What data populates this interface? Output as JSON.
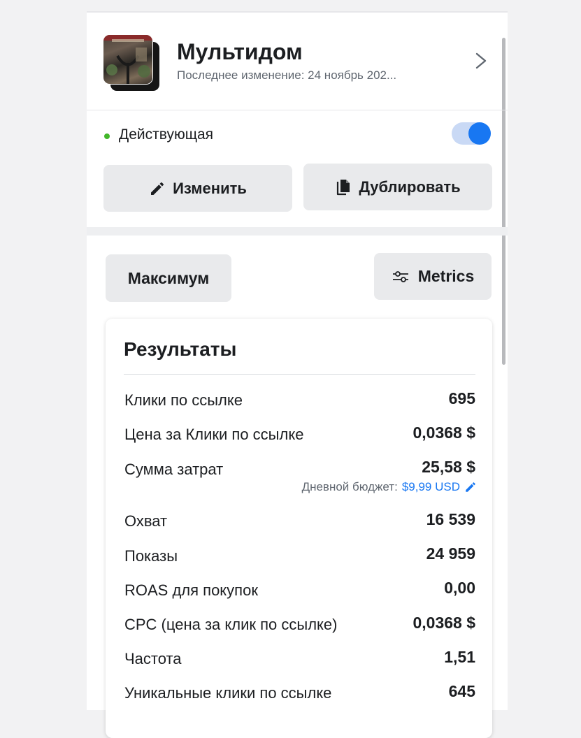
{
  "header": {
    "title": "Мультидом",
    "subtitle": "Последнее изменение: 24 ноябрь 202..."
  },
  "status": {
    "label": "Действующая",
    "enabled": true,
    "dot_color": "#42b72a",
    "toggle_color": "#1877f2"
  },
  "actions": {
    "edit_label": "Изменить",
    "duplicate_label": "Дублировать"
  },
  "filters": {
    "period_label": "Максимум",
    "metrics_label": "Metrics"
  },
  "results": {
    "title": "Результаты",
    "rows": [
      {
        "label": "Клики по ссылке",
        "value": "695"
      },
      {
        "label": "Цена за Клики по ссылке",
        "value": "0,0368 $"
      },
      {
        "label": "Сумма затрат",
        "value": "25,58 $"
      },
      {
        "label": "Охват",
        "value": "16 539"
      },
      {
        "label": "Показы",
        "value": "24 959"
      },
      {
        "label": "ROAS для покупок",
        "value": "0,00"
      },
      {
        "label": "CPC (цена за клик по ссылке)",
        "value": "0,0368 $"
      },
      {
        "label": "Частота",
        "value": "1,51"
      },
      {
        "label": "Уникальные клики по ссылке",
        "value": "645"
      }
    ],
    "budget_label": "Дневной бюджет:",
    "budget_amount": "$9,99 USD",
    "accent_color": "#1877f2"
  }
}
